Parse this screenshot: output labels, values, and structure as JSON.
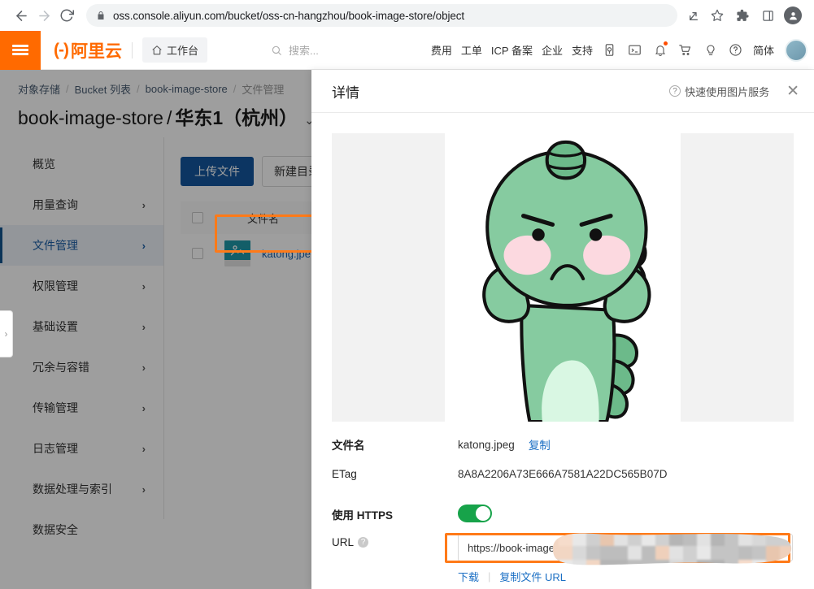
{
  "browser": {
    "url": "oss.console.aliyun.com/bucket/oss-cn-hangzhou/book-image-store/object",
    "back_icon": "back-arrow-icon",
    "forward_icon": "forward-arrow-icon",
    "reload_icon": "reload-icon",
    "lock_icon": "lock-icon",
    "share_icon": "share-icon",
    "bookmark_icon": "star-icon",
    "extensions_icon": "puzzle-icon",
    "sidepanel_icon": "side-panel-icon",
    "profile_icon": "profile-avatar-icon"
  },
  "topnav": {
    "menu_icon": "hamburger-menu-icon",
    "brand_mark": "(-)",
    "brand_text": "阿里云",
    "workbench_label": "工作台",
    "home_icon": "home-icon",
    "search_placeholder": "搜索...",
    "search_icon": "search-icon",
    "links": [
      {
        "label": "费用",
        "name": "nav-link-cost"
      },
      {
        "label": "工单",
        "name": "nav-link-ticket"
      },
      {
        "label": "ICP 备案",
        "name": "nav-link-icp"
      },
      {
        "label": "企业",
        "name": "nav-link-enterprise"
      },
      {
        "label": "支持",
        "name": "nav-link-support"
      }
    ],
    "icons": [
      {
        "name": "app-download-icon"
      },
      {
        "name": "cloud-shell-icon"
      },
      {
        "name": "notification-bell-icon",
        "has_badge": true
      },
      {
        "name": "shopping-cart-icon"
      },
      {
        "name": "tips-bulb-icon"
      },
      {
        "name": "help-circle-icon"
      }
    ],
    "language_label": "简体",
    "avatar": "user-avatar"
  },
  "breadcrumb": {
    "items": [
      "对象存储",
      "Bucket 列表",
      "book-image-store",
      "文件管理"
    ],
    "separator": "/"
  },
  "page": {
    "bucket_name": "book-image-store",
    "separator": "/",
    "region": "华东1（杭州）",
    "caret": "⌄"
  },
  "sidebar": {
    "items": [
      {
        "label": "概览",
        "has_chevron": false,
        "active": false,
        "name": "sidebar-item-overview"
      },
      {
        "label": "用量查询",
        "has_chevron": true,
        "active": false,
        "name": "sidebar-item-usage"
      },
      {
        "label": "文件管理",
        "has_chevron": true,
        "active": true,
        "name": "sidebar-item-file-management"
      },
      {
        "label": "权限管理",
        "has_chevron": true,
        "active": false,
        "name": "sidebar-item-permissions"
      },
      {
        "label": "基础设置",
        "has_chevron": true,
        "active": false,
        "name": "sidebar-item-basic-settings"
      },
      {
        "label": "冗余与容错",
        "has_chevron": true,
        "active": false,
        "name": "sidebar-item-redundancy"
      },
      {
        "label": "传输管理",
        "has_chevron": true,
        "active": false,
        "name": "sidebar-item-transfer"
      },
      {
        "label": "日志管理",
        "has_chevron": true,
        "active": false,
        "name": "sidebar-item-logging"
      },
      {
        "label": "数据处理与索引",
        "has_chevron": true,
        "active": false,
        "name": "sidebar-item-data-processing"
      },
      {
        "label": "数据安全",
        "has_chevron": false,
        "active": false,
        "name": "sidebar-item-data-security"
      }
    ],
    "chevron": "›",
    "collapse_icon": "chevron-right-icon"
  },
  "filelist": {
    "upload_label": "上传文件",
    "newdir_label": "新建目录",
    "col_filename": "文件名",
    "rows": [
      {
        "filename": "katong.jpe",
        "thumb_icon": "image-thumbnail-icon"
      }
    ]
  },
  "drawer": {
    "title": "详情",
    "help_label": "快速使用图片服务",
    "help_icon": "question-circle-icon",
    "close_icon": "close-icon",
    "preview_alt": "katong.jpeg preview",
    "fields": {
      "filename_label": "文件名",
      "filename_value": "katong.jpeg",
      "filename_copy": "复制",
      "etag_label": "ETag",
      "etag_value": "8A8A2206A73E666A7581A22DC565B07D",
      "https_label": "使用 HTTPS",
      "https_enabled": true,
      "url_label": "URL",
      "url_help_icon": "question-mark-icon",
      "url_value": "https://book-image-st",
      "download_label": "下载",
      "copy_url_label": "复制文件 URL",
      "separator": "|"
    }
  },
  "colors": {
    "brand_orange": "#ff6a00",
    "primary_blue": "#14569e",
    "link_blue": "#1b6fc4",
    "highlight_orange": "#ff7a18",
    "toggle_green": "#17a34a",
    "dino_body": "#86cba0",
    "dino_belly": "#d9f7e3",
    "dino_cheek": "#fcd9e0",
    "dino_outline": "#111111"
  }
}
